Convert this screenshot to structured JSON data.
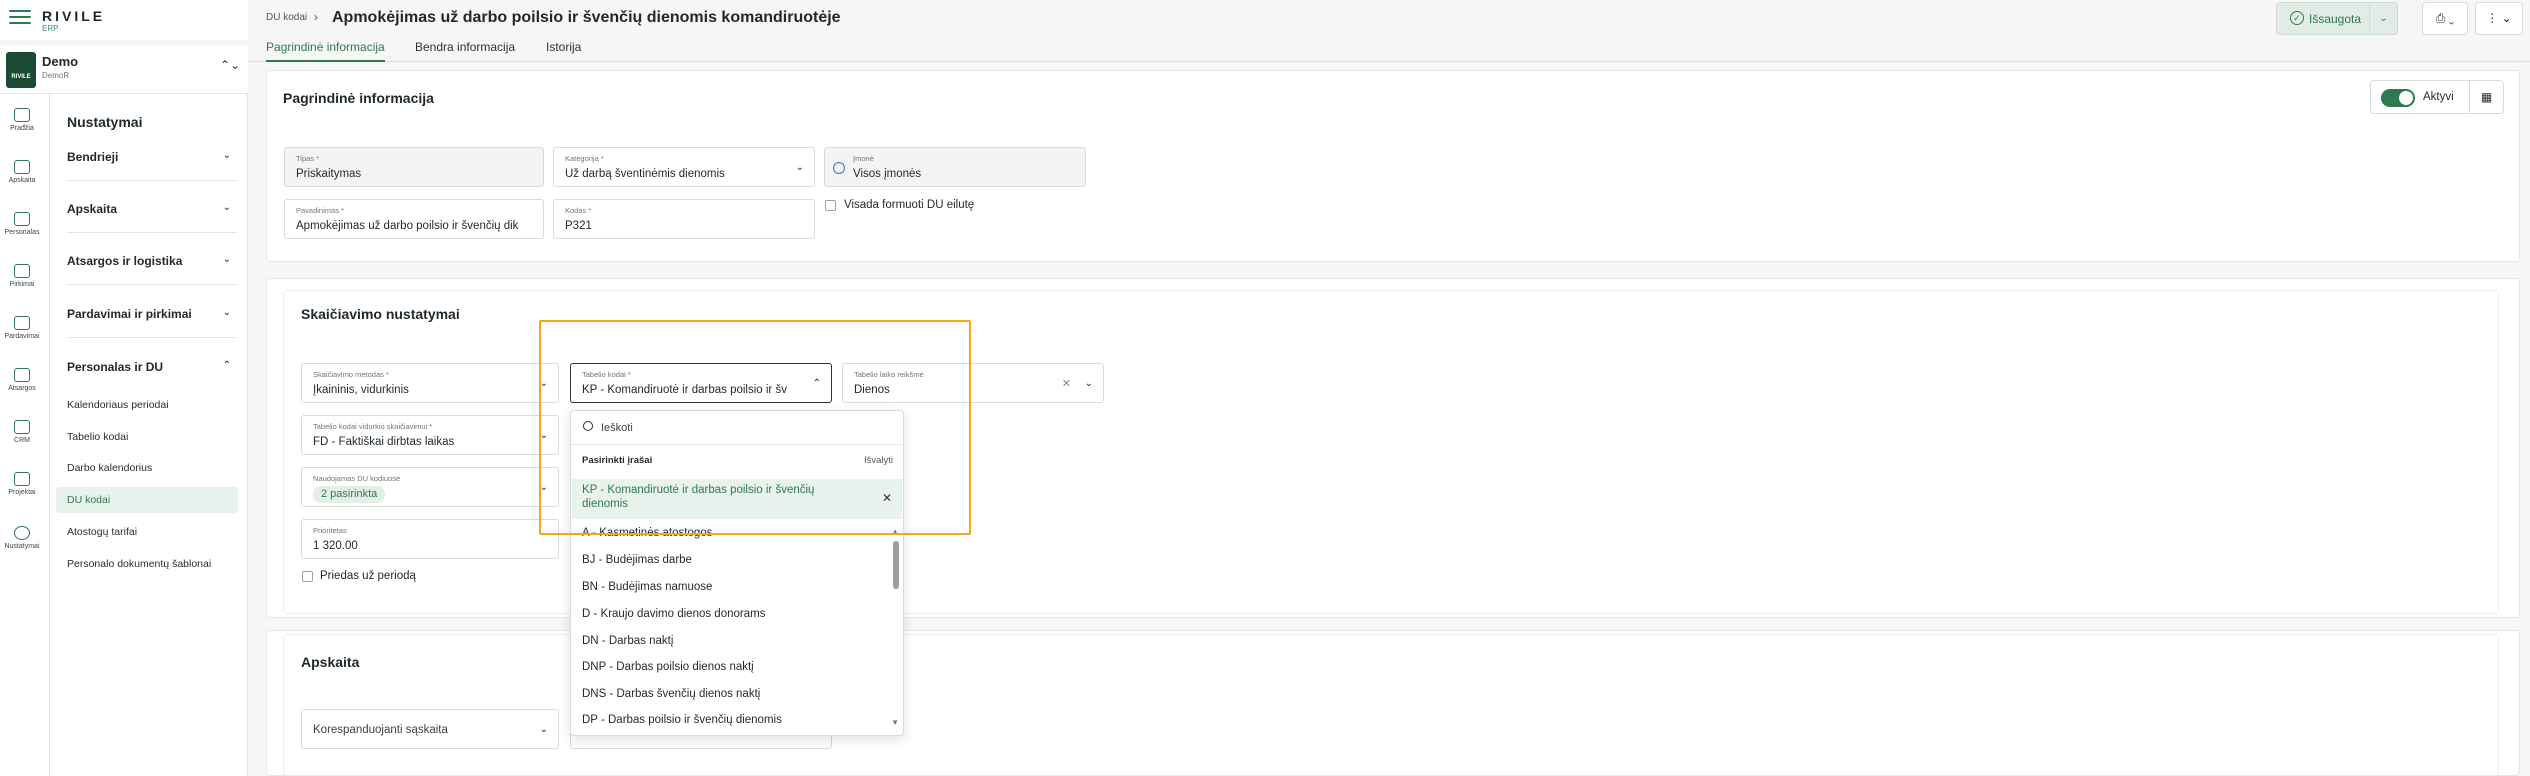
{
  "app": {
    "logo": "RIVILE",
    "logo_sub": "ERP"
  },
  "company": {
    "badge": "RIVILE",
    "name": "Demo",
    "sub": "DemoR"
  },
  "rail": [
    {
      "label": "Prađžia",
      "icon": "home-icon"
    },
    {
      "label": "Apskaita",
      "icon": "ledger-icon"
    },
    {
      "label": "Personalas",
      "icon": "people-icon"
    },
    {
      "label": "Pirkimai",
      "icon": "cart-icon"
    },
    {
      "label": "Pardavimai",
      "icon": "sales-icon"
    },
    {
      "label": "Atsargos",
      "icon": "stock-icon"
    },
    {
      "label": "CRM",
      "icon": "crm-icon"
    },
    {
      "label": "Projektai",
      "icon": "projects-icon"
    },
    {
      "label": "Nustatymai",
      "icon": "settings-icon"
    }
  ],
  "sidebar": {
    "title": "Nustatymai",
    "sections": [
      "Bendrieji",
      "Apskaita",
      "Atsargos ir logistika",
      "Pardavimai ir pirkimai",
      "Personalas ir DU"
    ],
    "sub_items": [
      "Kalendoriaus periodai",
      "Tabelio kodai",
      "Darbo kalendorius",
      "DU kodai",
      "Atostogų tarifai",
      "Personalo dokumentų šablonai"
    ]
  },
  "header": {
    "breadcrumb": "DU kodai",
    "title": "Apmokėjimas už darbo poilsio ir švenčių dienomis komandiruotėje",
    "tabs": [
      "Pagrindinė informacija",
      "Bendra informacija",
      "Istorija"
    ],
    "saved_label": "Išsaugota"
  },
  "main_info": {
    "title": "Pagrindinė informacija",
    "active_label": "Aktyvi",
    "fields": {
      "tipas": {
        "label": "Tipas *",
        "value": "Priskaitymas"
      },
      "kategorija": {
        "label": "Kategorija *",
        "value": "Už darbą šventinėmis dienomis"
      },
      "imone": {
        "label": "Įmonė",
        "value": "Visos įmonės"
      },
      "pavadinimas": {
        "label": "Pavadinimas *",
        "value": "Apmokėjimas už darbo poilsio ir švenčių  dik"
      },
      "kodas": {
        "label": "Kodas *",
        "value": "P321"
      }
    },
    "checkbox_label": "Visada formuoti DU eilutę"
  },
  "calc": {
    "title": "Skaičiavimo nustatymai",
    "fields": {
      "metodas": {
        "label": "Skaičiavimo metodas *",
        "value": "Įkaininis, vidurkinis"
      },
      "tabelio_kodai": {
        "label": "Tabelio kodai *",
        "value": "KP - Komandiruotė ir darbas poilsio ir šv"
      },
      "laiko_reiksme": {
        "label": "Tabelio laiko reikšmė",
        "value": "Dienos"
      },
      "vidurkio": {
        "label": "Tabelio kodai vidurkio skaičiavimui *",
        "value": "FD - Faktiškai dirbtas laikas"
      },
      "naudojamas": {
        "label": "Naudojamas DU kodiuose",
        "chip": "2 pasirinkta"
      },
      "prioritetas": {
        "label": "Prioritetas",
        "value": "1 320.00"
      }
    },
    "checkbox_label": "Priedas už periodą"
  },
  "dropdown": {
    "search_placeholder": "Ieškoti",
    "selected_header": "Pasirinkti įrašai",
    "clear_label": "Išvalyti",
    "selected_item": "KP - Komandiruotė ir darbas poilsio ir švenčių dienomis",
    "items": [
      "A - Kasmetinės atostogos",
      "BJ - Budėjimas darbe",
      "BN - Budėjimas namuose",
      "D - Kraujo davimo dienos donorams",
      "DN - Darbas naktį",
      "DNP - Darbas poilsio dienos naktį",
      "DNS - Darbas švenčių dienos naktį",
      "DP - Darbas poilsio ir švenčių dienomis"
    ]
  },
  "apskaita": {
    "title": "Apskaita",
    "korespondentas_placeholder": "Korespanduojanti sąskaita"
  },
  "colors": {
    "accent": "#2f7a4f",
    "highlight": "#f4a61d"
  }
}
